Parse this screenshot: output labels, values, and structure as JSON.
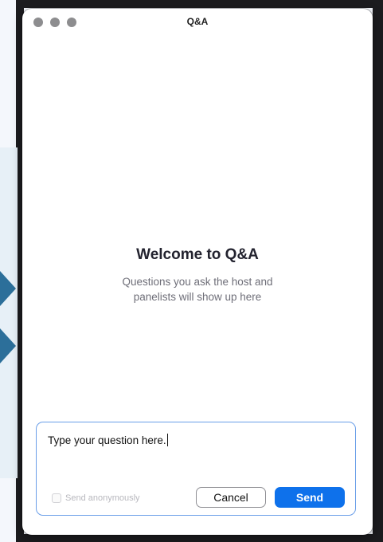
{
  "window": {
    "title": "Q&A"
  },
  "welcome": {
    "title": "Welcome to Q&A",
    "subtitle_line1": "Questions you ask the host and",
    "subtitle_line2": "panelists will show up here"
  },
  "compose": {
    "question_text": "Type your question here.",
    "anonymous_label": "Send anonymously",
    "anonymous_checked": false,
    "cancel_label": "Cancel",
    "send_label": "Send"
  },
  "colors": {
    "accent": "#0e71eb",
    "input_border": "#6a9ee8",
    "traffic_light": "#8d8d8f"
  },
  "icons": {
    "close": "close-dot-icon",
    "minimize": "minimize-dot-icon",
    "zoom": "zoom-dot-icon"
  }
}
